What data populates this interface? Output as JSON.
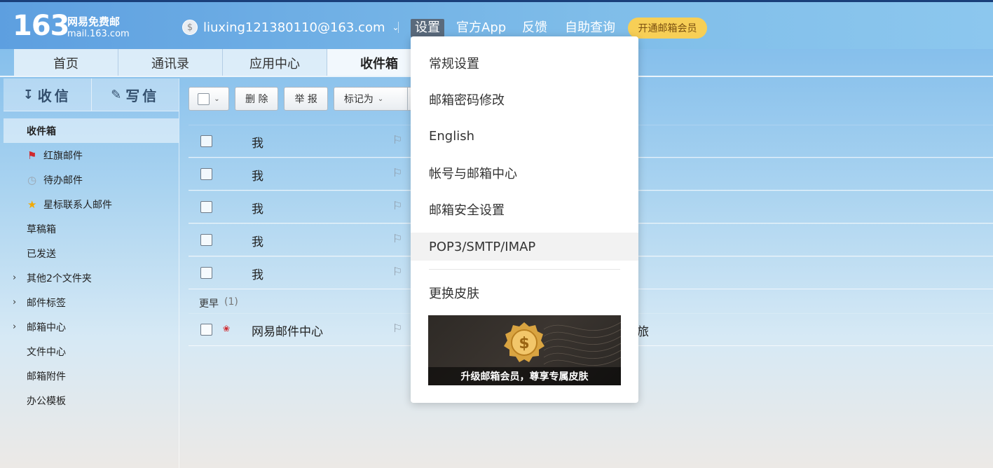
{
  "header": {
    "logo_num": "163",
    "logo_cn": "网易免费邮",
    "logo_domain": "mail.163.com",
    "account_email": "liuxing121380110@163.com",
    "nav": [
      "设置",
      "官方App",
      "反馈",
      "自助查询"
    ],
    "vip_label": "开通邮箱会员"
  },
  "tabs": [
    "首页",
    "通讯录",
    "应用中心",
    "收件箱"
  ],
  "sidebar": {
    "receive_label": "收信",
    "write_label": "写信",
    "folders": [
      "收件箱",
      "红旗邮件",
      "待办邮件",
      "星标联系人邮件",
      "草稿箱",
      "已发送",
      "其他2个文件夹",
      "邮件标签",
      "邮箱中心",
      "文件中心",
      "邮箱附件",
      "办公模板"
    ]
  },
  "toolbar": {
    "delete_label": "删 除",
    "report_label": "举 报",
    "markas_label": "标记为"
  },
  "mails": [
    {
      "sender": "我"
    },
    {
      "sender": "我"
    },
    {
      "sender": "我"
    },
    {
      "sender": "我"
    },
    {
      "sender": "我"
    }
  ],
  "earlier": {
    "label": "更早",
    "count": "(1)",
    "mail": {
      "sender": "网易邮件中心",
      "subject_tail": "旅"
    }
  },
  "settings_menu": {
    "items": [
      "常规设置",
      "邮箱密码修改",
      "English",
      "帐号与邮箱中心",
      "邮箱安全设置",
      "POP3/SMTP/IMAP"
    ],
    "skin_label": "更换皮肤",
    "promo_caption": "升级邮箱会员，尊享专属皮肤"
  },
  "colors": {
    "accent": "#5d9fe0",
    "vip": "#f7cf56",
    "flag_red": "#d0292e"
  }
}
